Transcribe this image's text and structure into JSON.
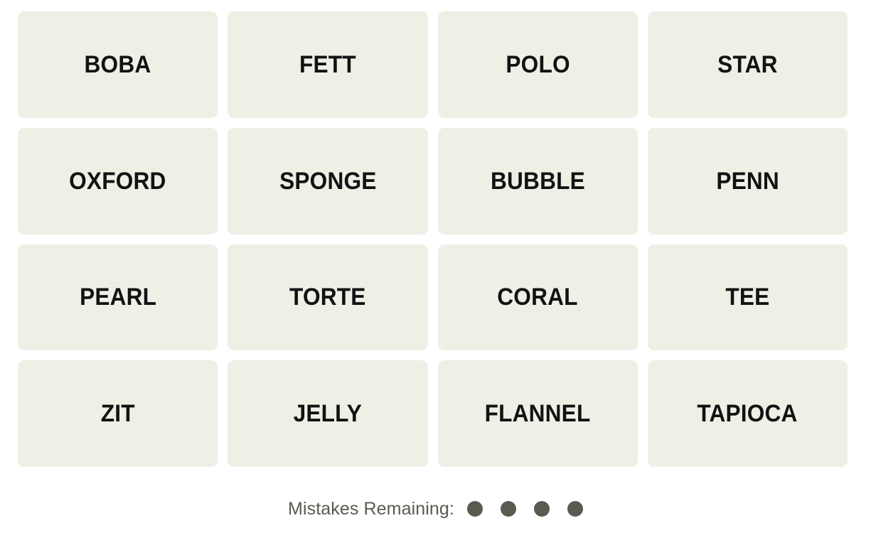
{
  "game": {
    "name": "Connections",
    "grid_rows": 4,
    "grid_columns": 4,
    "tile_color": "#EFEFE6",
    "tile_text_color": "#121212",
    "background_color": "#FFFFFF"
  },
  "board": {
    "tiles": [
      {
        "word": "BOBA",
        "row": 1,
        "col": 1,
        "selected": false
      },
      {
        "word": "FETT",
        "row": 1,
        "col": 2,
        "selected": false
      },
      {
        "word": "POLO",
        "row": 1,
        "col": 3,
        "selected": false
      },
      {
        "word": "STAR",
        "row": 1,
        "col": 4,
        "selected": false
      },
      {
        "word": "OXFORD",
        "row": 2,
        "col": 1,
        "selected": false
      },
      {
        "word": "SPONGE",
        "row": 2,
        "col": 2,
        "selected": false
      },
      {
        "word": "BUBBLE",
        "row": 2,
        "col": 3,
        "selected": false
      },
      {
        "word": "PENN",
        "row": 2,
        "col": 4,
        "selected": false
      },
      {
        "word": "PEARL",
        "row": 3,
        "col": 1,
        "selected": false
      },
      {
        "word": "TORTE",
        "row": 3,
        "col": 2,
        "selected": false
      },
      {
        "word": "CORAL",
        "row": 3,
        "col": 3,
        "selected": false
      },
      {
        "word": "TEE",
        "row": 3,
        "col": 4,
        "selected": false
      },
      {
        "word": "ZIT",
        "row": 4,
        "col": 1,
        "selected": false
      },
      {
        "word": "JELLY",
        "row": 4,
        "col": 2,
        "selected": false
      },
      {
        "word": "FLANNEL",
        "row": 4,
        "col": 3,
        "selected": false
      },
      {
        "word": "TAPIOCA",
        "row": 4,
        "col": 4,
        "selected": false
      }
    ]
  },
  "mistakes": {
    "label": "Mistakes Remaining:",
    "label_color": "#5A5A52",
    "remaining": 4,
    "total": 4,
    "dot_color": "#5A5A50"
  }
}
